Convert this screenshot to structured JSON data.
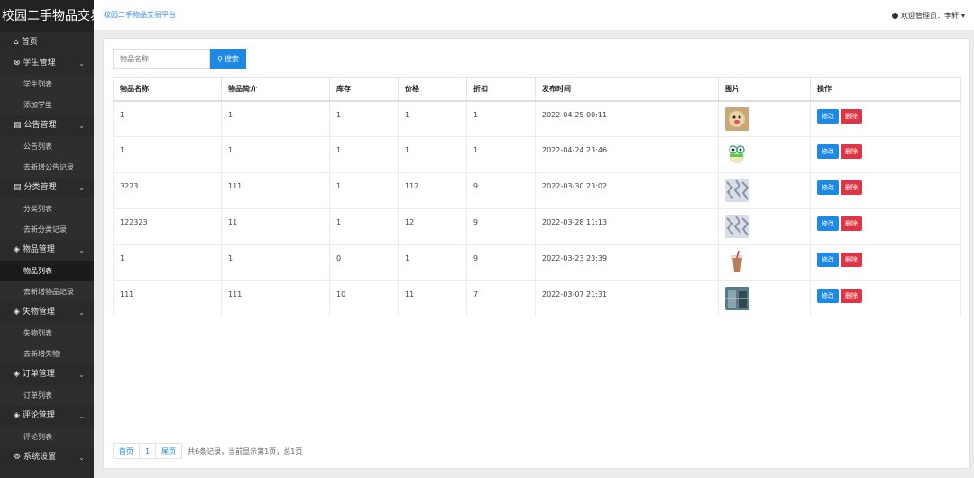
{
  "app": {
    "brand": "校园二手物品交易",
    "breadcrumb": "校园二手物品交易平台",
    "user_greeting": "欢迎管理员：李轩"
  },
  "sidebar": {
    "home": "首页",
    "groups": [
      {
        "label": "学生管理",
        "icon": "user-circle-icon",
        "items": [
          "学生列表",
          "添加学生"
        ]
      },
      {
        "label": "公告管理",
        "icon": "document-icon",
        "items": [
          "公告列表",
          "去新增公告记录"
        ]
      },
      {
        "label": "分类管理",
        "icon": "document-icon",
        "items": [
          "分类列表",
          "去新分类记录"
        ]
      },
      {
        "label": "物品管理",
        "icon": "layers-icon",
        "items": [
          "物品列表",
          "去新增物品记录"
        ]
      },
      {
        "label": "失物管理",
        "icon": "layers-icon",
        "items": [
          "失物列表",
          "去新增失物"
        ]
      },
      {
        "label": "订单管理",
        "icon": "layers-icon",
        "items": [
          "订单列表"
        ]
      },
      {
        "label": "评论管理",
        "icon": "layers-icon",
        "items": [
          "评论列表"
        ]
      },
      {
        "label": "系统设置",
        "icon": "gear-icon",
        "items": []
      }
    ],
    "active_item": "物品列表"
  },
  "search": {
    "placeholder": "物品名称",
    "button_label": "搜索"
  },
  "table": {
    "headers": [
      "物品名称",
      "物品简介",
      "库存",
      "价格",
      "折扣",
      "发布时间",
      "图片",
      "操作"
    ],
    "rows": [
      {
        "name": "1",
        "intro": "1",
        "stock": "1",
        "price": "1",
        "discount": "1",
        "time": "2022-04-25 00:11",
        "thumb": "dog-photo"
      },
      {
        "name": "1",
        "intro": "1",
        "stock": "1",
        "price": "1",
        "discount": "1",
        "time": "2022-04-24 23:46",
        "thumb": "frog-sticker"
      },
      {
        "name": "3223",
        "intro": "111",
        "stock": "1",
        "price": "112",
        "discount": "9",
        "time": "2022-03-30 23:02",
        "thumb": "pattern-photo"
      },
      {
        "name": "122323",
        "intro": "11",
        "stock": "1",
        "price": "12",
        "discount": "9",
        "time": "2022-03-28 11:13",
        "thumb": "pattern-photo"
      },
      {
        "name": "1",
        "intro": "1",
        "stock": "0",
        "price": "1",
        "discount": "9",
        "time": "2022-03-23 23:39",
        "thumb": "milk-tea-photo"
      },
      {
        "name": "111",
        "intro": "111",
        "stock": "10",
        "price": "11",
        "discount": "7",
        "time": "2022-03-07 21:31",
        "thumb": "building-photo"
      }
    ],
    "edit_label": "修改",
    "delete_label": "删除"
  },
  "pager": {
    "first": "首页",
    "page": "1",
    "last": "尾页",
    "info": "共6条记录，当前显示第1页，总1页"
  },
  "colors": {
    "primary": "#1e88e5",
    "danger": "#dc3545",
    "sidebar": "#2a2a2a"
  }
}
